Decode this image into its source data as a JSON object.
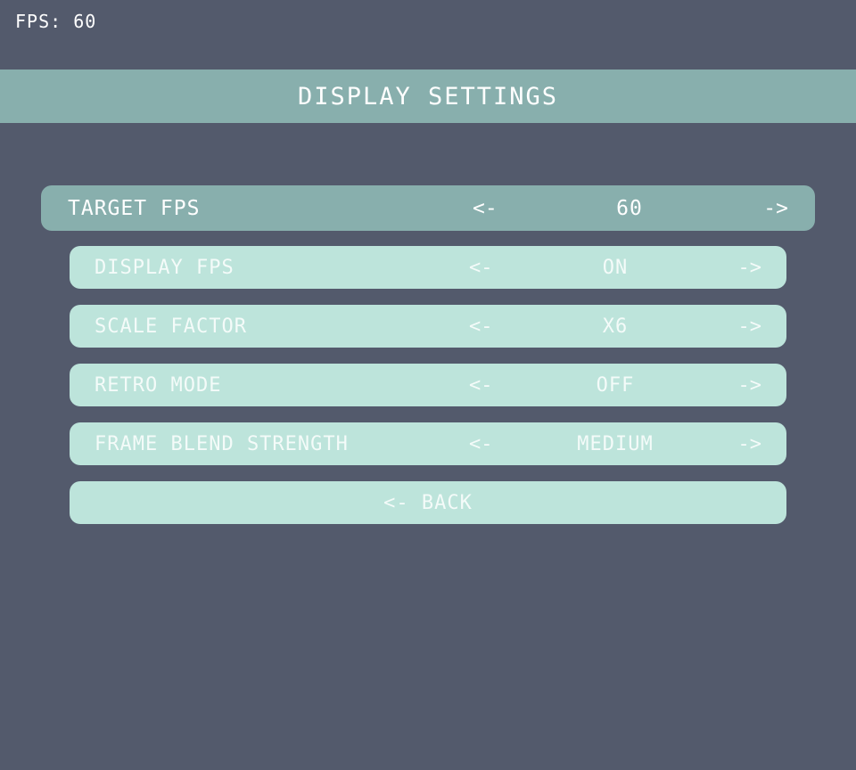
{
  "fps_counter": "FPS: 60",
  "header": {
    "title": "DISPLAY SETTINGS",
    "background": "#88afad"
  },
  "colors": {
    "background": "#535a6c",
    "selected_row": "#88afad",
    "row": "#bde4db",
    "text": "#ffffff"
  },
  "settings": [
    {
      "label": "TARGET FPS",
      "left_arrow": "<-",
      "value": "60",
      "right_arrow": "->",
      "selected": true
    },
    {
      "label": "DISPLAY FPS",
      "left_arrow": "<-",
      "value": "ON",
      "right_arrow": "->",
      "selected": false
    },
    {
      "label": "SCALE FACTOR",
      "left_arrow": "<-",
      "value": "X6",
      "right_arrow": "->",
      "selected": false
    },
    {
      "label": "RETRO MODE",
      "left_arrow": "<-",
      "value": "OFF",
      "right_arrow": "->",
      "selected": false
    },
    {
      "label": "FRAME BLEND STRENGTH",
      "left_arrow": "<-",
      "value": "MEDIUM",
      "right_arrow": "->",
      "selected": false
    }
  ],
  "back_button": {
    "label": "<- BACK"
  }
}
